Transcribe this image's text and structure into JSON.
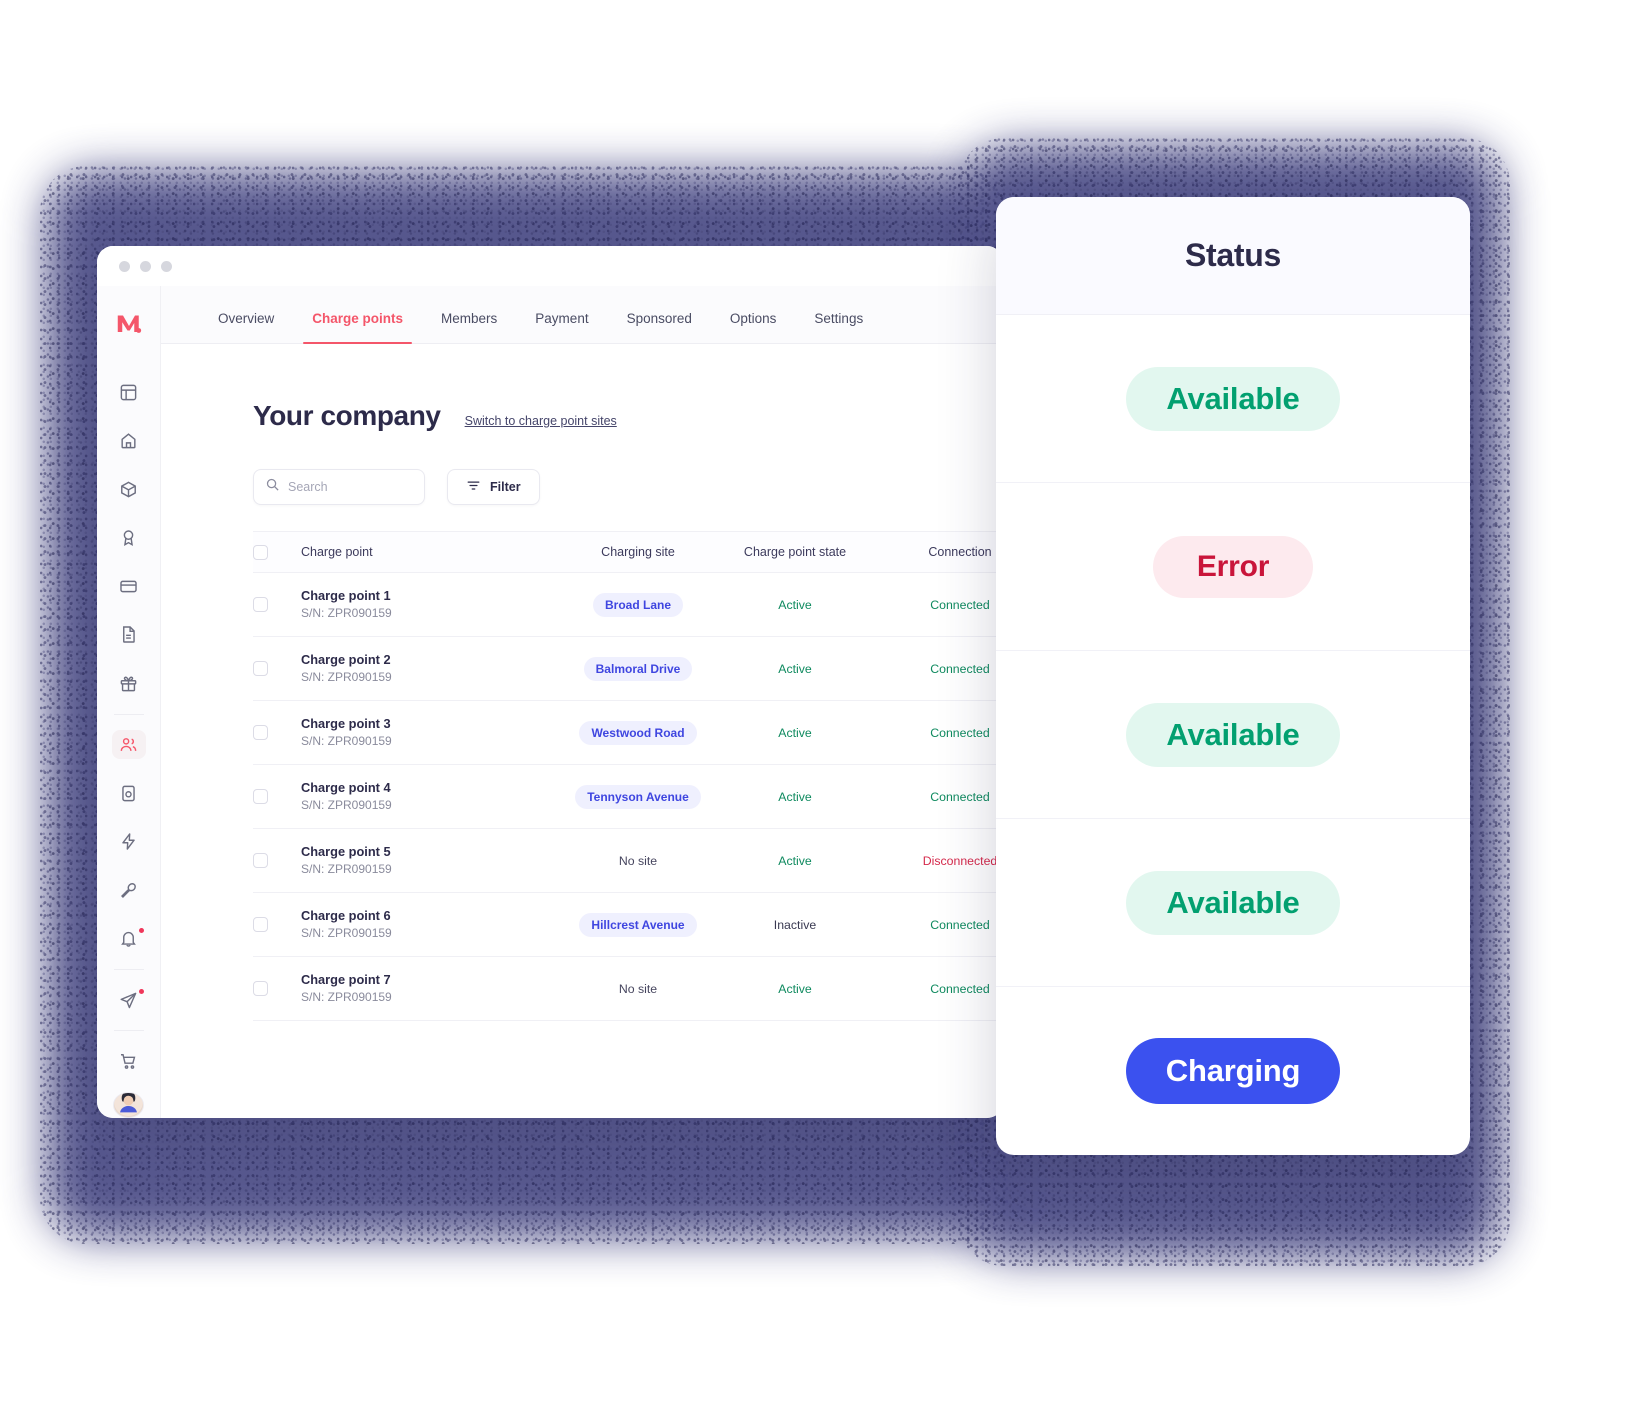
{
  "window": {
    "traffic_lights": [
      "close",
      "minimize",
      "maximize"
    ]
  },
  "brand": {
    "logo_glyph": "M."
  },
  "sidebar": {
    "items": [
      {
        "icon": "layout-dashboard-icon",
        "name": "dashboard",
        "active": false,
        "dot": false
      },
      {
        "icon": "home-icon",
        "name": "home",
        "active": false,
        "dot": false
      },
      {
        "icon": "box-icon",
        "name": "products",
        "active": false,
        "dot": false
      },
      {
        "icon": "award-icon",
        "name": "awards",
        "active": false,
        "dot": false
      },
      {
        "icon": "credit-card-icon",
        "name": "billing",
        "active": false,
        "dot": false
      },
      {
        "icon": "file-text-icon",
        "name": "documents",
        "active": false,
        "dot": false
      },
      {
        "icon": "gift-icon",
        "name": "rewards",
        "active": false,
        "dot": false
      },
      {
        "icon": "users-icon",
        "name": "company",
        "active": true,
        "dot": false
      },
      {
        "icon": "device-icon",
        "name": "devices",
        "active": false,
        "dot": false
      },
      {
        "icon": "bolt-icon",
        "name": "charging",
        "active": false,
        "dot": false
      },
      {
        "icon": "wrench-icon",
        "name": "service",
        "active": false,
        "dot": false
      },
      {
        "icon": "bell-icon",
        "name": "notifications",
        "active": false,
        "dot": true
      },
      {
        "icon": "send-icon",
        "name": "messages",
        "active": false,
        "dot": true
      },
      {
        "icon": "cart-icon",
        "name": "shop",
        "active": false,
        "dot": false
      }
    ],
    "avatar_name": "user-avatar"
  },
  "tabs": [
    {
      "label": "Overview",
      "active": false
    },
    {
      "label": "Charge points",
      "active": true
    },
    {
      "label": "Members",
      "active": false
    },
    {
      "label": "Payment",
      "active": false
    },
    {
      "label": "Sponsored",
      "active": false
    },
    {
      "label": "Options",
      "active": false
    },
    {
      "label": "Settings",
      "active": false
    }
  ],
  "page": {
    "title": "Your company",
    "switch_link": "Switch to charge point sites"
  },
  "toolbar": {
    "search_placeholder": "Search",
    "search_value": "",
    "filter_label": "Filter",
    "search_icon": "search-icon",
    "filter_icon": "filter-icon"
  },
  "table": {
    "columns": [
      "Charge point",
      "Charging site",
      "Charge point state",
      "Connection"
    ],
    "rows": [
      {
        "name": "Charge point 1",
        "serial": "S/N: ZPR090159",
        "site": "Broad Lane",
        "site_badge": true,
        "state": "Active",
        "state_kind": "active",
        "connection": "Connected",
        "connection_kind": "ok"
      },
      {
        "name": "Charge point 2",
        "serial": "S/N: ZPR090159",
        "site": "Balmoral Drive",
        "site_badge": true,
        "state": "Active",
        "state_kind": "active",
        "connection": "Connected",
        "connection_kind": "ok"
      },
      {
        "name": "Charge point 3",
        "serial": "S/N: ZPR090159",
        "site": "Westwood Road",
        "site_badge": true,
        "state": "Active",
        "state_kind": "active",
        "connection": "Connected",
        "connection_kind": "ok"
      },
      {
        "name": "Charge point 4",
        "serial": "S/N: ZPR090159",
        "site": "Tennyson Avenue",
        "site_badge": true,
        "state": "Active",
        "state_kind": "active",
        "connection": "Connected",
        "connection_kind": "ok"
      },
      {
        "name": "Charge point 5",
        "serial": "S/N: ZPR090159",
        "site": "No site",
        "site_badge": false,
        "state": "Active",
        "state_kind": "active",
        "connection": "Disconnected",
        "connection_kind": "bad"
      },
      {
        "name": "Charge point 6",
        "serial": "S/N: ZPR090159",
        "site": "Hillcrest Avenue",
        "site_badge": true,
        "state": "Inactive",
        "state_kind": "inactive",
        "connection": "Connected",
        "connection_kind": "ok"
      },
      {
        "name": "Charge point 7",
        "serial": "S/N: ZPR090159",
        "site": "No site",
        "site_badge": false,
        "state": "Active",
        "state_kind": "active",
        "connection": "Connected",
        "connection_kind": "ok"
      }
    ]
  },
  "status_panel": {
    "title": "Status",
    "items": [
      {
        "label": "Available",
        "kind": "available"
      },
      {
        "label": "Error",
        "kind": "error"
      },
      {
        "label": "Available",
        "kind": "available"
      },
      {
        "label": "Available",
        "kind": "available"
      },
      {
        "label": "Charging",
        "kind": "charging"
      }
    ]
  },
  "colors": {
    "accent_red": "#f4566a",
    "brand_blue": "#3b51ef",
    "site_badge_bg": "#eff0fe",
    "site_badge_text": "#3f46e0",
    "success_green": "#0f8a5f",
    "available_green": "#02a070",
    "available_bg": "#e2f7ef",
    "error_red": "#c9153a",
    "error_bg": "#fdeaee",
    "danger_red": "#d5294b",
    "halo_purple": "#4a4b86",
    "title_ink": "#2d2b4a"
  }
}
